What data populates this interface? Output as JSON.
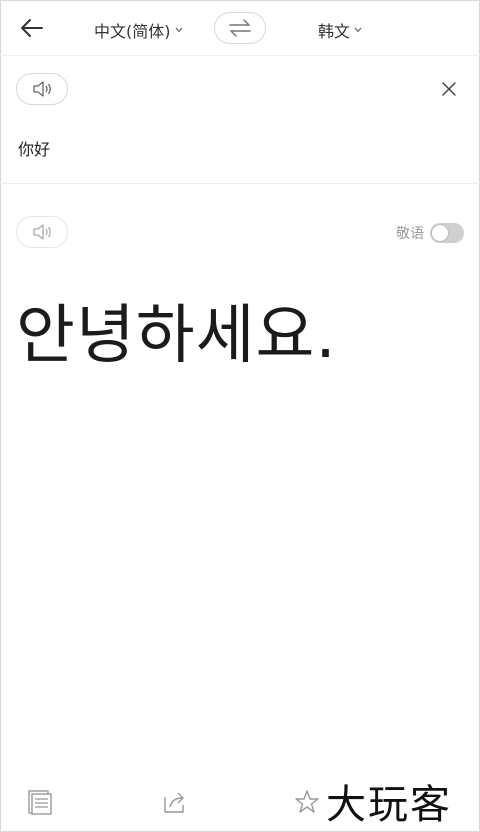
{
  "header": {
    "source_language": "中文(简体)",
    "target_language": "韩文"
  },
  "source": {
    "text": "你好"
  },
  "result": {
    "text": "안녕하세요.",
    "honorific_label": "敬语",
    "honorific_on": false
  },
  "watermark": "大玩客",
  "icons": {
    "back": "back-arrow-icon",
    "swap": "swap-arrows-icon",
    "speaker": "speaker-icon",
    "close": "close-icon",
    "copy": "copy-icon",
    "share": "share-icon",
    "star": "star-icon"
  }
}
